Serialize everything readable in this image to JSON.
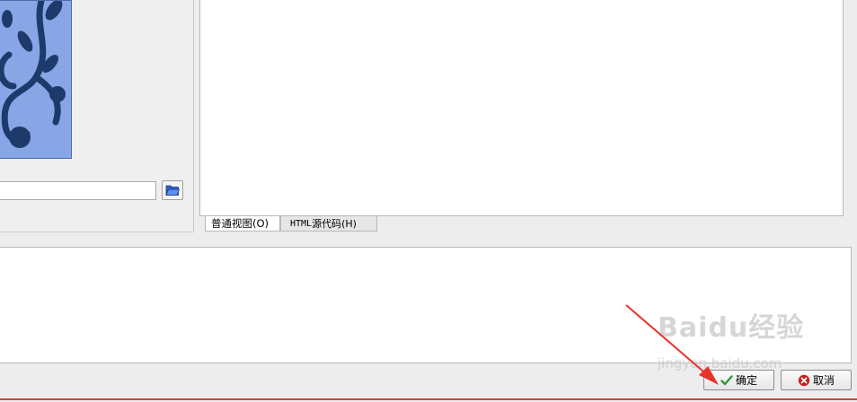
{
  "left_panel": {
    "image_path_value": "",
    "browse_icon": "folder-open-icon"
  },
  "editor": {
    "tabs": [
      {
        "label": "普通视图(O)",
        "active": true
      },
      {
        "label_mono": "HTML",
        "label_rest": " 源代码(H)",
        "active": false
      }
    ]
  },
  "description": {
    "value": ""
  },
  "buttons": {
    "ok_label": "确定",
    "cancel_label": "取消",
    "ok_icon": "checkmark-icon",
    "cancel_icon": "cancel-icon"
  },
  "watermark": {
    "logo_text": "Baidu经验",
    "url_text": "jingyan.baidu.com"
  },
  "colors": {
    "preview_bg": "#88a6e6",
    "preview_pattern": "#1d3a6b",
    "bottom_line": "#c7473c",
    "annotation_arrow": "#e8332a",
    "ok_check": "#2e9b2e",
    "cancel_icon": "#c8211d"
  }
}
